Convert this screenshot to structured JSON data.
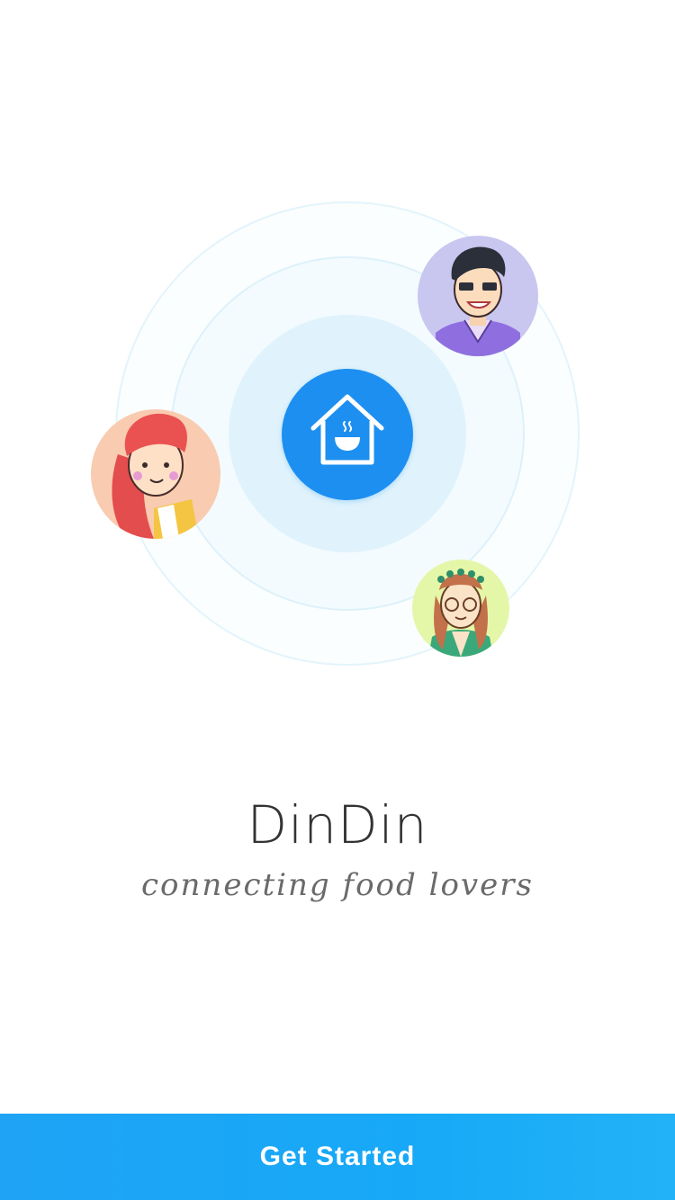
{
  "app": {
    "name": "DinDin",
    "tagline": "connecting food lovers"
  },
  "hero": {
    "logo_icon": "house-with-bowl-icon",
    "avatars": [
      {
        "name": "man-avatar",
        "description_icon": "man-with-black-hair-avatar"
      },
      {
        "name": "redhead-avatar",
        "description_icon": "woman-with-red-hair-avatar"
      },
      {
        "name": "glasses-avatar",
        "description_icon": "woman-with-glasses-flower-crown-avatar"
      }
    ]
  },
  "cta": {
    "label": "Get Started"
  },
  "colors": {
    "accent": "#1d8ff0",
    "button": "#1ba6f6",
    "ring_light": "#e0f3fc"
  }
}
